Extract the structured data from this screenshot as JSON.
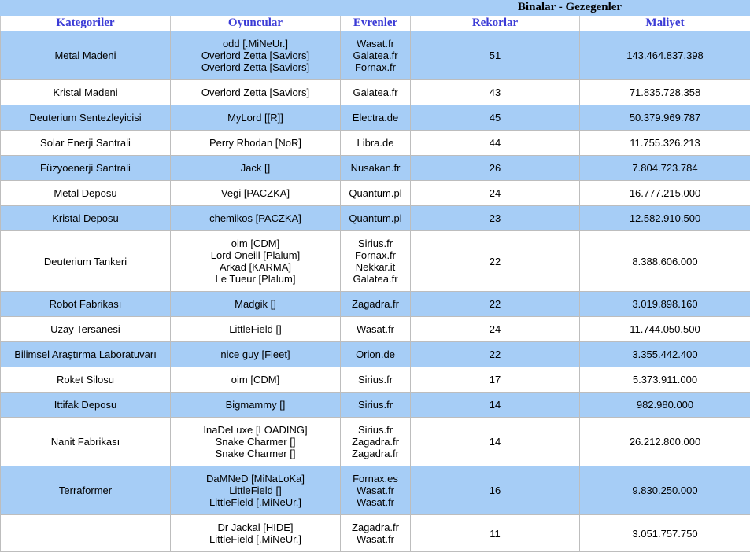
{
  "header": {
    "title": "Binalar - Gezegenler",
    "columns": [
      "Kategoriler",
      "Oyuncular",
      "Evrenler",
      "Rekorlar",
      "Maliyet"
    ]
  },
  "colors": {
    "header_bar": "#a6cdf6",
    "header_text": "#3b3bd6",
    "row_blue": "#a6cdf6",
    "row_white": "#ffffff"
  },
  "rows": [
    {
      "category": "Metal Madeni",
      "players": [
        "odd [.MiNeUr.]",
        "Overlord Zetta [Saviors]",
        "Overlord Zetta [Saviors]"
      ],
      "universes": [
        "Wasat.fr",
        "Galatea.fr",
        "Fornax.fr"
      ],
      "record": "51",
      "cost": "143.464.837.398"
    },
    {
      "category": "Kristal Madeni",
      "players": [
        "Overlord Zetta [Saviors]"
      ],
      "universes": [
        "Galatea.fr"
      ],
      "record": "43",
      "cost": "71.835.728.358"
    },
    {
      "category": "Deuterium Sentezleyicisi",
      "players": [
        "MyLord [[R]]"
      ],
      "universes": [
        "Electra.de"
      ],
      "record": "45",
      "cost": "50.379.969.787"
    },
    {
      "category": "Solar Enerji Santrali",
      "players": [
        "Perry Rhodan [NoR]"
      ],
      "universes": [
        "Libra.de"
      ],
      "record": "44",
      "cost": "11.755.326.213"
    },
    {
      "category": "Füzyoenerji Santrali",
      "players": [
        "Jack []"
      ],
      "universes": [
        "Nusakan.fr"
      ],
      "record": "26",
      "cost": "7.804.723.784"
    },
    {
      "category": "Metal Deposu",
      "players": [
        "Vegi [PACZKA]"
      ],
      "universes": [
        "Quantum.pl"
      ],
      "record": "24",
      "cost": "16.777.215.000"
    },
    {
      "category": "Kristal Deposu",
      "players": [
        "chemikos [PACZKA]"
      ],
      "universes": [
        "Quantum.pl"
      ],
      "record": "23",
      "cost": "12.582.910.500"
    },
    {
      "category": "Deuterium Tankeri",
      "players": [
        "oim [CDM]",
        "Lord Oneill [Plalum]",
        "Arkad [KARMA]",
        "Le Tueur [Plalum]"
      ],
      "universes": [
        "Sirius.fr",
        "Fornax.fr",
        "Nekkar.it",
        "Galatea.fr"
      ],
      "record": "22",
      "cost": "8.388.606.000"
    },
    {
      "category": "Robot Fabrikası",
      "players": [
        "Madgik []"
      ],
      "universes": [
        "Zagadra.fr"
      ],
      "record": "22",
      "cost": "3.019.898.160"
    },
    {
      "category": "Uzay Tersanesi",
      "players": [
        "LittleField []"
      ],
      "universes": [
        "Wasat.fr"
      ],
      "record": "24",
      "cost": "11.744.050.500"
    },
    {
      "category": "Bilimsel Araştırma Laboratuvarı",
      "players": [
        "nice guy [Fleet]"
      ],
      "universes": [
        "Orion.de"
      ],
      "record": "22",
      "cost": "3.355.442.400"
    },
    {
      "category": "Roket Silosu",
      "players": [
        "oim [CDM]"
      ],
      "universes": [
        "Sirius.fr"
      ],
      "record": "17",
      "cost": "5.373.911.000"
    },
    {
      "category": "Ittifak Deposu",
      "players": [
        "Bigmammy []"
      ],
      "universes": [
        "Sirius.fr"
      ],
      "record": "14",
      "cost": "982.980.000"
    },
    {
      "category": "Nanit Fabrikası",
      "players": [
        "InaDeLuxe [LOADING]",
        "Snake Charmer []",
        "Snake Charmer []"
      ],
      "universes": [
        "Sirius.fr",
        "Zagadra.fr",
        "Zagadra.fr"
      ],
      "record": "14",
      "cost": "26.212.800.000"
    },
    {
      "category": "Terraformer",
      "players": [
        "DaMNeD [MiNaLoKa]",
        "LittleField []",
        "LittleField [.MiNeUr.]"
      ],
      "universes": [
        "Fornax.es",
        "Wasat.fr",
        "Wasat.fr"
      ],
      "record": "16",
      "cost": "9.830.250.000"
    },
    {
      "category": "",
      "players": [
        "Dr Jackal [HIDE]",
        "LittleField [.MiNeUr.]"
      ],
      "universes": [
        "Zagadra.fr",
        "Wasat.fr"
      ],
      "record": "11",
      "cost": "3.051.757.750"
    }
  ]
}
